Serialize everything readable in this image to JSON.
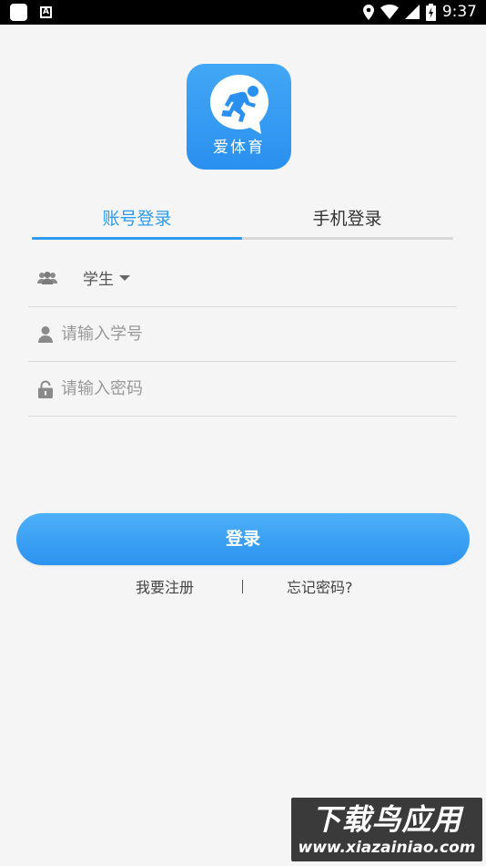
{
  "status_bar": {
    "time": "9:37",
    "notification_letter": "A"
  },
  "logo": {
    "text": "爱体育",
    "brand_color": "#2a90ef"
  },
  "tabs": [
    {
      "label": "账号登录",
      "active": true
    },
    {
      "label": "手机登录",
      "active": false
    }
  ],
  "form": {
    "role": {
      "value": "学生"
    },
    "student_id": {
      "placeholder": "请输入学号",
      "value": ""
    },
    "password": {
      "placeholder": "请输入密码",
      "value": ""
    }
  },
  "login_button": {
    "label": "登录"
  },
  "links": {
    "register": "我要注册",
    "forgot": "忘记密码?"
  },
  "watermark": {
    "title": "下载鸟应用",
    "url": "www.xiazainiao.com"
  },
  "colors": {
    "accent": "#2d9bef",
    "background": "#f5f5f5"
  }
}
